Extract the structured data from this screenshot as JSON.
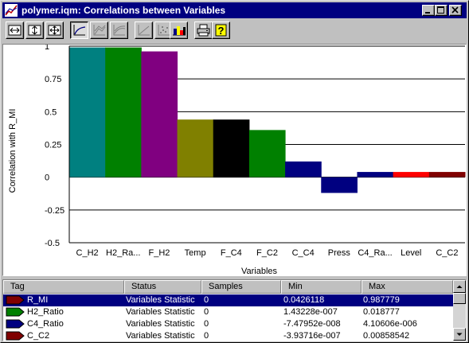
{
  "window": {
    "title": "polymer.iqm: Correlations between Variables"
  },
  "toolbar": {
    "buttons": [
      {
        "name": "zoom-horizontal-icon"
      },
      {
        "name": "zoom-vertical-icon"
      },
      {
        "name": "zoom-both-icon"
      },
      {
        "name": "line-chart-icon",
        "pressed": true
      },
      {
        "name": "area-chart-icon"
      },
      {
        "name": "surface-chart-icon"
      },
      {
        "name": "trend-chart-icon"
      },
      {
        "name": "scatter-chart-icon"
      },
      {
        "name": "color-bar-icon"
      },
      {
        "name": "print-icon"
      },
      {
        "name": "help-icon"
      }
    ]
  },
  "chart_data": {
    "type": "bar",
    "categories": [
      "C_H2",
      "H2_Ra...",
      "F_H2",
      "Temp",
      "F_C4",
      "F_C2",
      "C_C4",
      "Press",
      "C4_Ra...",
      "Level",
      "C_C2"
    ],
    "values": [
      0.99,
      0.99,
      0.96,
      0.44,
      0.44,
      0.36,
      0.12,
      -0.12,
      0.04,
      0.04,
      0.04
    ],
    "colors": [
      "#008080",
      "#008000",
      "#800080",
      "#808000",
      "#000000",
      "#008000",
      "#000080",
      "#000080",
      "#000080",
      "#ff0000",
      "#800000"
    ],
    "xlabel": "Variables",
    "ylabel": "Correlation with R_MI",
    "ylim": [
      -0.5,
      1
    ],
    "yticks": [
      1,
      0.75,
      0.5,
      0.25,
      0,
      -0.25,
      -0.5
    ],
    "ytick_labels": [
      "1",
      "0.75",
      "0.5",
      "0.25",
      "0",
      "-0.25",
      "-0.5"
    ],
    "grid": true
  },
  "table": {
    "headers": [
      "Tag",
      "Status",
      "Samples",
      "Min",
      "Max"
    ],
    "rows": [
      {
        "tag": "R_MI",
        "status": "Variables Statistic",
        "samples": "0",
        "min": "0.0426118",
        "max": "0.987779",
        "color": "#800000",
        "selected": true
      },
      {
        "tag": "H2_Ratio",
        "status": "Variables Statistic",
        "samples": "0",
        "min": "1.43228e-007",
        "max": "0.018777",
        "color": "#008000",
        "selected": false
      },
      {
        "tag": "C4_Ratio",
        "status": "Variables Statistic",
        "samples": "0",
        "min": "-7.47952e-008",
        "max": "4.10606e-006",
        "color": "#000080",
        "selected": false
      },
      {
        "tag": "C_C2",
        "status": "Variables Statistic",
        "samples": "0",
        "min": "-3.93716e-007",
        "max": "0.00858542",
        "color": "#800000",
        "selected": false
      }
    ]
  }
}
